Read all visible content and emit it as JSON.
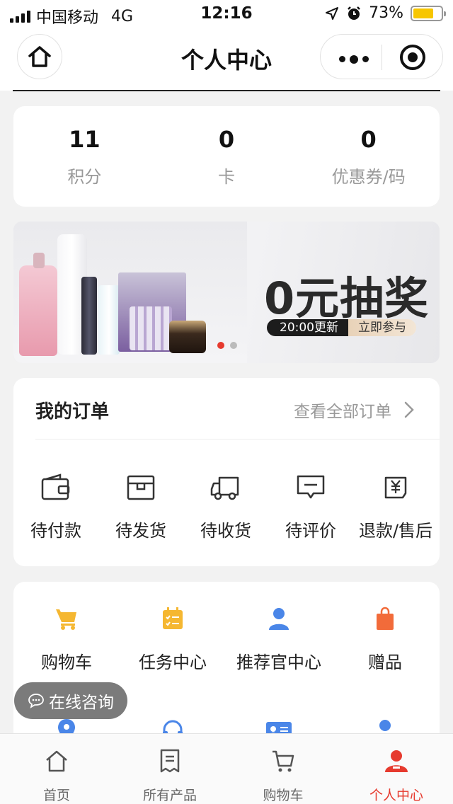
{
  "status_bar": {
    "carrier": "中国移动",
    "network": "4G",
    "time": "12:16",
    "battery": "73%",
    "battery_level": 0.73
  },
  "nav": {
    "title": "个人中心"
  },
  "stats": [
    {
      "value": "11",
      "label": "积分"
    },
    {
      "value": "0",
      "label": "卡"
    },
    {
      "value": "0",
      "label": "优惠券/码"
    }
  ],
  "banner": {
    "title": "0元抽奖",
    "update_text": "20:00更新",
    "join_text": "立即参与"
  },
  "orders": {
    "heading": "我的订单",
    "view_all": "查看全部订单",
    "items": [
      {
        "label": "待付款",
        "icon": "wallet-icon"
      },
      {
        "label": "待发货",
        "icon": "box-icon"
      },
      {
        "label": "待收货",
        "icon": "truck-icon"
      },
      {
        "label": "待评价",
        "icon": "comment-icon"
      },
      {
        "label": "退款/售后",
        "icon": "refund-icon"
      }
    ]
  },
  "tools": [
    {
      "label": "购物车",
      "icon": "cart-icon",
      "color": "#f5b731"
    },
    {
      "label": "任务中心",
      "icon": "task-icon",
      "color": "#f5b731"
    },
    {
      "label": "推荐官中心",
      "icon": "person-icon",
      "color": "#4a86e8"
    },
    {
      "label": "赠品",
      "icon": "gift-bag-icon",
      "color": "#f26b3a"
    }
  ],
  "consult": {
    "label": "在线咨询"
  },
  "tabs": [
    {
      "label": "首页",
      "icon": "home-icon",
      "active": false
    },
    {
      "label": "所有产品",
      "icon": "document-icon",
      "active": false
    },
    {
      "label": "购物车",
      "icon": "cart-icon",
      "active": false
    },
    {
      "label": "个人中心",
      "icon": "user-icon",
      "active": true
    }
  ],
  "colors": {
    "accent": "#e63a2e",
    "tool_yellow": "#f5b731",
    "tool_blue": "#4a86e8",
    "tool_orange": "#f26b3a"
  }
}
